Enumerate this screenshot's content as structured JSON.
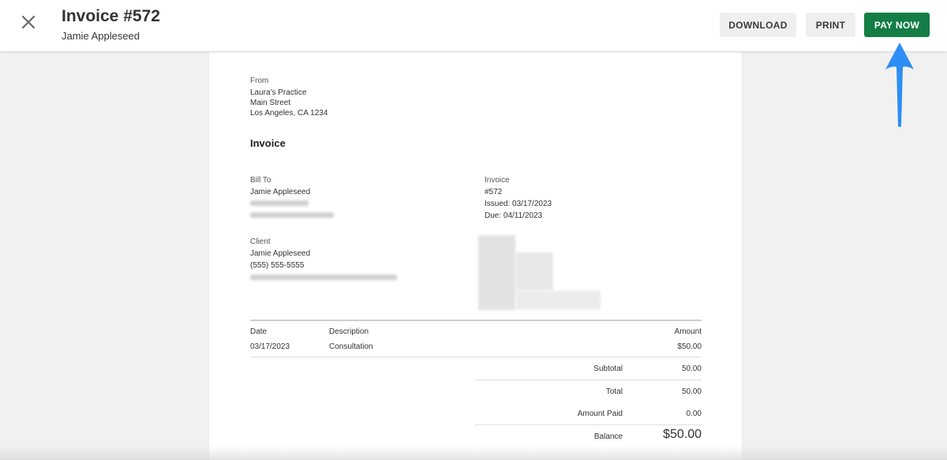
{
  "header": {
    "title": "Invoice #572",
    "subtitle": "Jamie Appleseed",
    "download_label": "DOWNLOAD",
    "print_label": "PRINT",
    "pay_now_label": "PAY NOW"
  },
  "colors": {
    "pay_button": "#137d45",
    "arrow": "#2d8ef5",
    "page_background": "#f1f1f1"
  },
  "invoice": {
    "from_label": "From",
    "from_lines": [
      "Laura's Practice",
      "Main Street",
      "Los Angeles, CA 1234"
    ],
    "heading": "Invoice",
    "bill_to_label": "Bill To",
    "bill_to_name": "Jamie Appleseed",
    "invoice_label": "Invoice",
    "invoice_number": "#572",
    "issued": "Issued: 03/17/2023",
    "due": "Due: 04/11/2023",
    "client_label": "Client",
    "client_name": "Jamie Appleseed",
    "client_phone": "(555) 555-5555"
  },
  "table": {
    "headers": {
      "date": "Date",
      "description": "Description",
      "amount": "Amount"
    },
    "rows": [
      {
        "date": "03/17/2023",
        "description": "Consultation",
        "amount": "$50.00"
      }
    ]
  },
  "totals": {
    "subtotal_label": "Subtotal",
    "subtotal_value": "50.00",
    "total_label": "Total",
    "total_value": "50.00",
    "amount_paid_label": "Amount Paid",
    "amount_paid_value": "0.00",
    "balance_label": "Balance",
    "balance_value": "$50.00"
  }
}
